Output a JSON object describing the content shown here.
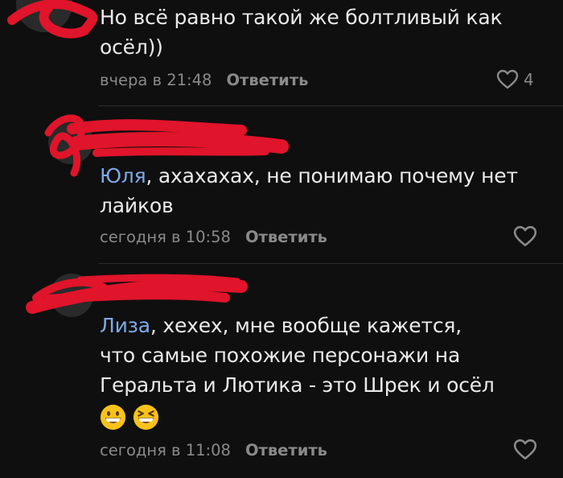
{
  "comments": [
    {
      "author_hidden": true,
      "text_lines": [
        "Но всё равно такой же болтливый как",
        "осёл))"
      ],
      "time": "вчера в 21:48",
      "reply_label": "Ответить",
      "likes": "4"
    },
    {
      "author_hidden": true,
      "mention": "Юля",
      "text_first_rest": ", ахахахах, не понимаю почему нет",
      "text_line2": "лайков",
      "time": "сегодня в 10:58",
      "reply_label": "Ответить"
    },
    {
      "author_hidden": true,
      "mention": "Лиза",
      "text_first_rest": ", хехех, мне вообще кажется,",
      "text_line2": "что самые похожие персонажи на",
      "text_line3": "Геральта и Лютика - это Шрек и осёл",
      "emojis": [
        "grinning-face-emoji",
        "squinting-face-emoji"
      ],
      "time": "сегодня в 11:08",
      "reply_label": "Ответить"
    }
  ],
  "colors": {
    "background": "#0f0f0f",
    "text": "#eaeaea",
    "meta": "#8a8a8a",
    "mention": "#7ea9e8",
    "redaction": "#e0142a"
  }
}
